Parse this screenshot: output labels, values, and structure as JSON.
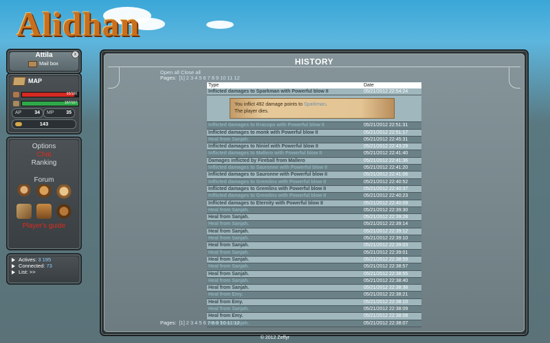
{
  "logo_text": "Alidhan",
  "user": {
    "name": "Attila",
    "mailbox": "Mail box",
    "close": "x"
  },
  "stats": {
    "map_label": "MAP",
    "hp_text": "93/100",
    "hp_fraction": 0.93,
    "xp_text": "167/167",
    "xp_fraction": 1.0,
    "ap_label": "AP",
    "ap_value": "34",
    "mp_label": "MP",
    "mp_value": "35",
    "gold": "143",
    "colors": {
      "hp": "#d42a22",
      "xp": "#2fa84a"
    }
  },
  "menu": {
    "options": "Options",
    "chat": "Chat",
    "ranking": "Ranking",
    "forum": "Forum",
    "guide": "Player's guide",
    "forum_icons": [
      "warrior-icon",
      "hero-group-icon",
      "tent-icon",
      "scroll-icon",
      "castle-icon",
      "sword-icon"
    ]
  },
  "online": {
    "actives_label": "Actives:",
    "actives_value": "3 195",
    "connected_label": "Connected:",
    "connected_value": "73",
    "list_label": "List: >>"
  },
  "history": {
    "title": "HISTORY",
    "open_all": "Open all",
    "close_all": "Close all",
    "pages_label": "Pages:",
    "pages": [
      "[1]",
      "2",
      "3",
      "4",
      "5",
      "6",
      "7",
      "8",
      "9",
      "10",
      "11",
      "12"
    ],
    "col_type": "Type",
    "col_date": "Date",
    "detail": {
      "line1_pre": "You inflict 492 damage points to ",
      "line1_who": "Sparkman",
      "line1_post": ".",
      "line2": "The player dies."
    },
    "rows": [
      {
        "type": "Inflicted damages to Sparkman with Powerful blow II",
        "date": "05/21/2012 22:54:24",
        "hl": false
      },
      {
        "type": "Inflicted damages to Kracops with Powerful blow II",
        "date": "05/21/2012 22:51:31",
        "hl": true
      },
      {
        "type": "Inflicted damages to monk with Powerful blow II",
        "date": "05/21/2012 22:51:17",
        "hl": false
      },
      {
        "type": "Heal from Sanjah.",
        "date": "05/21/2012 22:45:31",
        "hl": true
      },
      {
        "type": "Inflicted damages to Niniel with Powerful blow II",
        "date": "05/21/2012 22:43:29",
        "hl": false
      },
      {
        "type": "Inflicted damages to Mallero with Powerful blow II",
        "date": "05/21/2012 22:41:40",
        "hl": true
      },
      {
        "type": "Damages inflicted by Fireball from Mallero",
        "date": "05/21/2012 22:41:36",
        "hl": false
      },
      {
        "type": "Inflicted damages to Sauronne with Powerful blow II",
        "date": "05/21/2012 22:41:20",
        "hl": true
      },
      {
        "type": "Inflicted damages to Sauronne with Powerful blow II",
        "date": "05/21/2012 22:41:06",
        "hl": false
      },
      {
        "type": "Inflicted damages to Gremlins with Powerful blow II",
        "date": "05/21/2012 22:40:52",
        "hl": true
      },
      {
        "type": "Inflicted damages to Gremlins with Powerful blow II",
        "date": "05/21/2012 22:40:37",
        "hl": false
      },
      {
        "type": "Inflicted damages to Gremlins with Powerful blow II",
        "date": "05/21/2012 22:40:23",
        "hl": true
      },
      {
        "type": "Inflicted damages to Eternity with Powerful blow II",
        "date": "05/21/2012 22:40:09",
        "hl": false
      },
      {
        "type": "Heal from Sanjah.",
        "date": "05/21/2012 22:39:30",
        "hl": true
      },
      {
        "type": "Heal from Sanjah.",
        "date": "05/21/2012 22:39:28",
        "hl": false
      },
      {
        "type": "Heal from Sanjah.",
        "date": "05/21/2012 22:39:14",
        "hl": true
      },
      {
        "type": "Heal from Sanjah.",
        "date": "05/21/2012 22:39:12",
        "hl": false
      },
      {
        "type": "Heal from Sanjah.",
        "date": "05/21/2012 22:39:10",
        "hl": true
      },
      {
        "type": "Heal from Sanjah.",
        "date": "05/21/2012 22:39:03",
        "hl": false
      },
      {
        "type": "Heal from Sanjah.",
        "date": "05/21/2012 22:39:01",
        "hl": true
      },
      {
        "type": "Heal from Sanjah.",
        "date": "05/21/2012 22:38:59",
        "hl": false
      },
      {
        "type": "Heal from Sanjah.",
        "date": "05/21/2012 22:38:57",
        "hl": true
      },
      {
        "type": "Heal from Sanjah.",
        "date": "05/21/2012 22:38:55",
        "hl": false
      },
      {
        "type": "Heal from Sanjah.",
        "date": "05/21/2012 22:38:40",
        "hl": true
      },
      {
        "type": "Heal from Sanjah.",
        "date": "05/21/2012 22:38:38",
        "hl": false
      },
      {
        "type": "Heal from Emy.",
        "date": "05/21/2012 22:38:21",
        "hl": true
      },
      {
        "type": "Heal from Emy.",
        "date": "05/21/2012 22:38:10",
        "hl": false
      },
      {
        "type": "Heal from Sanjah.",
        "date": "05/21/2012 22:38:09",
        "hl": true
      },
      {
        "type": "Heal from Emy.",
        "date": "05/21/2012 22:38:08",
        "hl": false
      },
      {
        "type": "Heal from Sanjah.",
        "date": "05/21/2012 22:38:07",
        "hl": true
      }
    ]
  },
  "footer": "© 2012 Zeffyr"
}
